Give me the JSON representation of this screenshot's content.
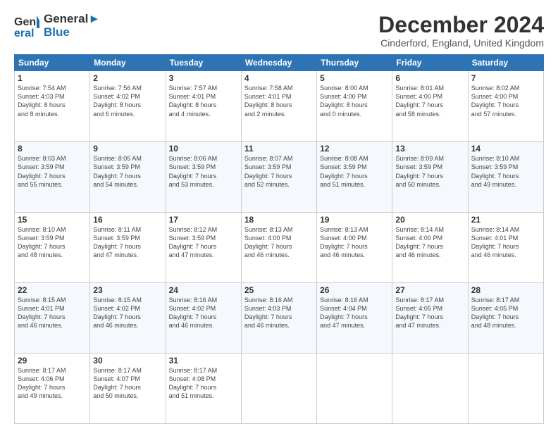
{
  "header": {
    "logo_line1": "General",
    "logo_line2": "Blue",
    "month": "December 2024",
    "location": "Cinderford, England, United Kingdom"
  },
  "weekdays": [
    "Sunday",
    "Monday",
    "Tuesday",
    "Wednesday",
    "Thursday",
    "Friday",
    "Saturday"
  ],
  "weeks": [
    [
      {
        "day": "1",
        "info": "Sunrise: 7:54 AM\nSunset: 4:03 PM\nDaylight: 8 hours\nand 8 minutes."
      },
      {
        "day": "2",
        "info": "Sunrise: 7:56 AM\nSunset: 4:02 PM\nDaylight: 8 hours\nand 6 minutes."
      },
      {
        "day": "3",
        "info": "Sunrise: 7:57 AM\nSunset: 4:01 PM\nDaylight: 8 hours\nand 4 minutes."
      },
      {
        "day": "4",
        "info": "Sunrise: 7:58 AM\nSunset: 4:01 PM\nDaylight: 8 hours\nand 2 minutes."
      },
      {
        "day": "5",
        "info": "Sunrise: 8:00 AM\nSunset: 4:00 PM\nDaylight: 8 hours\nand 0 minutes."
      },
      {
        "day": "6",
        "info": "Sunrise: 8:01 AM\nSunset: 4:00 PM\nDaylight: 7 hours\nand 58 minutes."
      },
      {
        "day": "7",
        "info": "Sunrise: 8:02 AM\nSunset: 4:00 PM\nDaylight: 7 hours\nand 57 minutes."
      }
    ],
    [
      {
        "day": "8",
        "info": "Sunrise: 8:03 AM\nSunset: 3:59 PM\nDaylight: 7 hours\nand 55 minutes."
      },
      {
        "day": "9",
        "info": "Sunrise: 8:05 AM\nSunset: 3:59 PM\nDaylight: 7 hours\nand 54 minutes."
      },
      {
        "day": "10",
        "info": "Sunrise: 8:06 AM\nSunset: 3:59 PM\nDaylight: 7 hours\nand 53 minutes."
      },
      {
        "day": "11",
        "info": "Sunrise: 8:07 AM\nSunset: 3:59 PM\nDaylight: 7 hours\nand 52 minutes."
      },
      {
        "day": "12",
        "info": "Sunrise: 8:08 AM\nSunset: 3:59 PM\nDaylight: 7 hours\nand 51 minutes."
      },
      {
        "day": "13",
        "info": "Sunrise: 8:09 AM\nSunset: 3:59 PM\nDaylight: 7 hours\nand 50 minutes."
      },
      {
        "day": "14",
        "info": "Sunrise: 8:10 AM\nSunset: 3:59 PM\nDaylight: 7 hours\nand 49 minutes."
      }
    ],
    [
      {
        "day": "15",
        "info": "Sunrise: 8:10 AM\nSunset: 3:59 PM\nDaylight: 7 hours\nand 48 minutes."
      },
      {
        "day": "16",
        "info": "Sunrise: 8:11 AM\nSunset: 3:59 PM\nDaylight: 7 hours\nand 47 minutes."
      },
      {
        "day": "17",
        "info": "Sunrise: 8:12 AM\nSunset: 3:59 PM\nDaylight: 7 hours\nand 47 minutes."
      },
      {
        "day": "18",
        "info": "Sunrise: 8:13 AM\nSunset: 4:00 PM\nDaylight: 7 hours\nand 46 minutes."
      },
      {
        "day": "19",
        "info": "Sunrise: 8:13 AM\nSunset: 4:00 PM\nDaylight: 7 hours\nand 46 minutes."
      },
      {
        "day": "20",
        "info": "Sunrise: 8:14 AM\nSunset: 4:00 PM\nDaylight: 7 hours\nand 46 minutes."
      },
      {
        "day": "21",
        "info": "Sunrise: 8:14 AM\nSunset: 4:01 PM\nDaylight: 7 hours\nand 46 minutes."
      }
    ],
    [
      {
        "day": "22",
        "info": "Sunrise: 8:15 AM\nSunset: 4:01 PM\nDaylight: 7 hours\nand 46 minutes."
      },
      {
        "day": "23",
        "info": "Sunrise: 8:15 AM\nSunset: 4:02 PM\nDaylight: 7 hours\nand 46 minutes."
      },
      {
        "day": "24",
        "info": "Sunrise: 8:16 AM\nSunset: 4:02 PM\nDaylight: 7 hours\nand 46 minutes."
      },
      {
        "day": "25",
        "info": "Sunrise: 8:16 AM\nSunset: 4:03 PM\nDaylight: 7 hours\nand 46 minutes."
      },
      {
        "day": "26",
        "info": "Sunrise: 8:16 AM\nSunset: 4:04 PM\nDaylight: 7 hours\nand 47 minutes."
      },
      {
        "day": "27",
        "info": "Sunrise: 8:17 AM\nSunset: 4:05 PM\nDaylight: 7 hours\nand 47 minutes."
      },
      {
        "day": "28",
        "info": "Sunrise: 8:17 AM\nSunset: 4:05 PM\nDaylight: 7 hours\nand 48 minutes."
      }
    ],
    [
      {
        "day": "29",
        "info": "Sunrise: 8:17 AM\nSunset: 4:06 PM\nDaylight: 7 hours\nand 49 minutes."
      },
      {
        "day": "30",
        "info": "Sunrise: 8:17 AM\nSunset: 4:07 PM\nDaylight: 7 hours\nand 50 minutes."
      },
      {
        "day": "31",
        "info": "Sunrise: 8:17 AM\nSunset: 4:08 PM\nDaylight: 7 hours\nand 51 minutes."
      },
      {
        "day": "",
        "info": ""
      },
      {
        "day": "",
        "info": ""
      },
      {
        "day": "",
        "info": ""
      },
      {
        "day": "",
        "info": ""
      }
    ]
  ]
}
